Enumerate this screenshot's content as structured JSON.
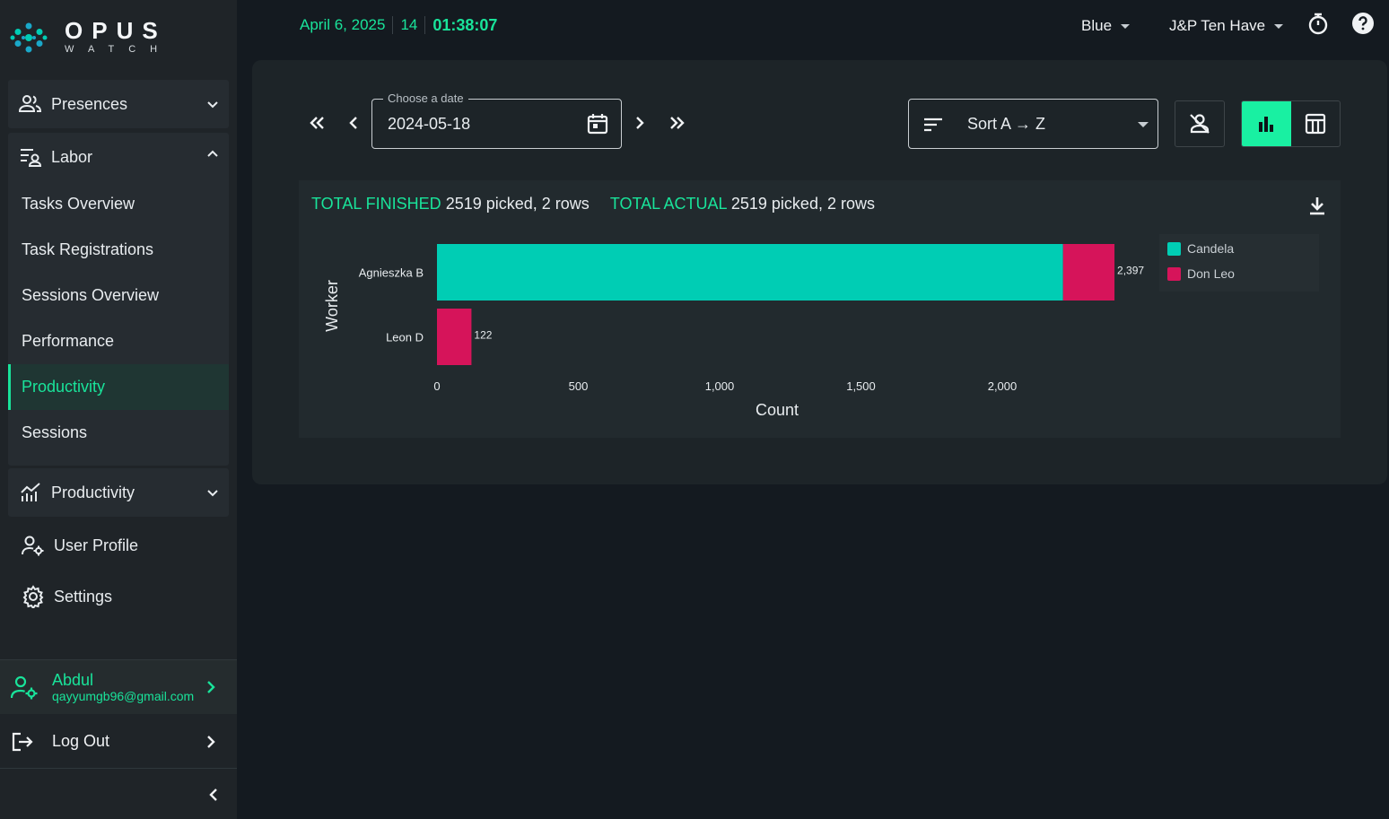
{
  "app": {
    "logo_top": "OPUS",
    "logo_bottom": "WATCH"
  },
  "topbar": {
    "date": "April 6, 2025",
    "week": "14",
    "time": "01:38:07",
    "team": "Blue",
    "company": "J&P Ten Have",
    "icons": [
      "stopwatch-icon",
      "help-icon"
    ]
  },
  "sidebar": {
    "presences": "Presences",
    "labor": "Labor",
    "labor_items": [
      {
        "label": "Tasks Overview"
      },
      {
        "label": "Task Registrations"
      },
      {
        "label": "Sessions Overview"
      },
      {
        "label": "Performance"
      },
      {
        "label": "Productivity",
        "active": true
      },
      {
        "label": "Sessions"
      }
    ],
    "productivity": "Productivity",
    "user_profile": "User Profile",
    "settings": "Settings",
    "user": {
      "name": "Abdul",
      "email": "qayyumgb96@gmail.com"
    },
    "logout": "Log Out"
  },
  "toolbar": {
    "date_legend": "Choose a date",
    "date_value": "2024-05-18",
    "sort_value": "Sort A → Z"
  },
  "summary": {
    "finished_key": "TOTAL FINISHED",
    "finished_val": "2519 picked, 2 rows",
    "actual_key": "TOTAL ACTUAL",
    "actual_val": "2519 picked, 2 rows"
  },
  "colors": {
    "accent": "#19e39a",
    "candela": "#00cdb4",
    "don_leo": "#d6145a"
  },
  "chart_data": {
    "type": "bar",
    "orientation": "horizontal",
    "stacked": true,
    "categories": [
      "Agnieszka B",
      "Leon D"
    ],
    "series": [
      {
        "name": "Candela",
        "values": [
          2215,
          0
        ]
      },
      {
        "name": "Don Leo",
        "values": [
          182,
          122
        ]
      }
    ],
    "totals": [
      "2,397",
      "122"
    ],
    "xlabel": "Count",
    "ylabel": "Worker",
    "xlim": [
      0,
      2500
    ],
    "xticks": [
      0,
      500,
      1000,
      1500,
      2000
    ],
    "xtick_labels": [
      "0",
      "500",
      "1,000",
      "1,500",
      "2,000"
    ],
    "legend_position": "top-right",
    "grid": false
  }
}
